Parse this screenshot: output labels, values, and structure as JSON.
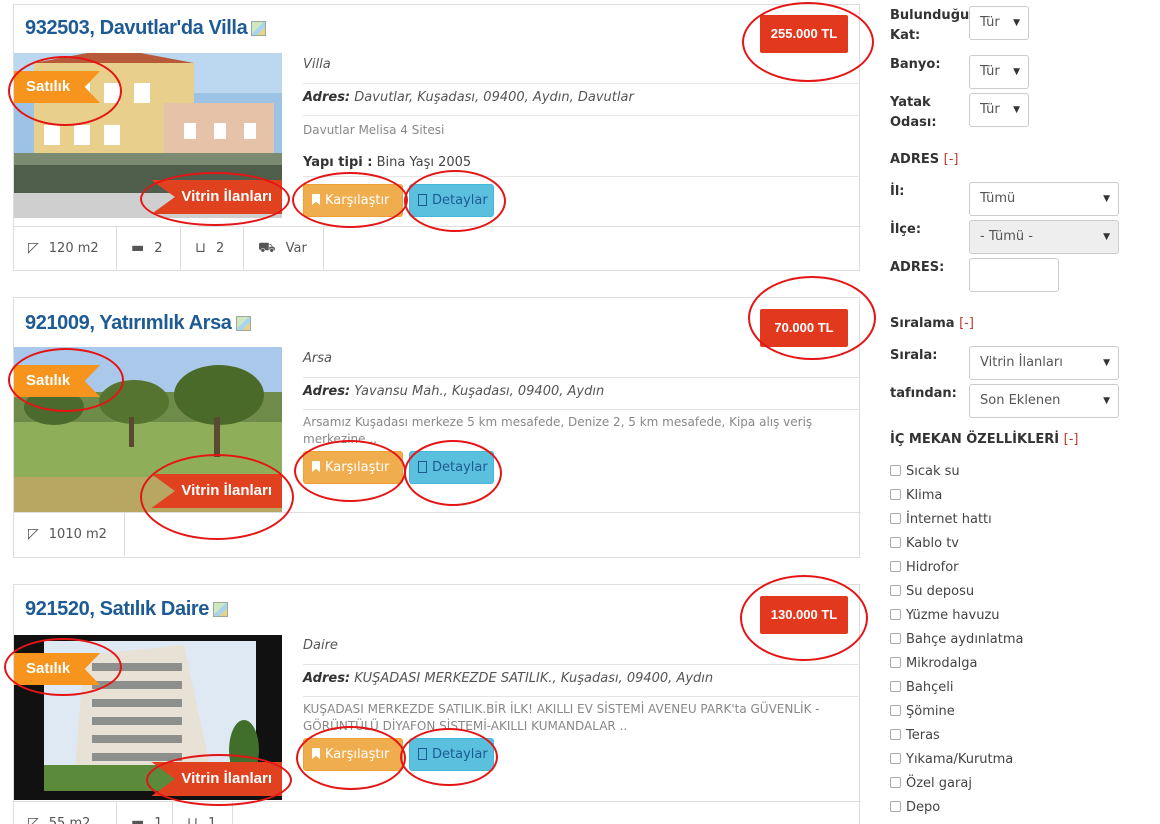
{
  "listings": [
    {
      "title": "932503, Davutlar'da Villa",
      "price": "255.000 TL",
      "tag_sale": "Satılık",
      "tag_showcase": "Vitrin İlanları",
      "type": "Villa",
      "address_label": "Adres:",
      "address": "Davutlar, Kuşadası, 09400, Aydın, Davutlar",
      "description": "Davutlar Melisa 4 Sitesi",
      "yapi_label": "Yapı tipi :",
      "yapi_value": "Bina Yaşı 2005",
      "compare_label": "Karşılaştır",
      "detail_label": "Detaylar",
      "features": [
        {
          "icon": "area-icon",
          "value": "120 m2"
        },
        {
          "icon": "bed-icon",
          "value": "2"
        },
        {
          "icon": "bath-icon",
          "value": "2"
        },
        {
          "icon": "car-icon",
          "value": "Var"
        }
      ]
    },
    {
      "title": "921009, Yatırımlık Arsa",
      "price": "70.000 TL",
      "tag_sale": "Satılık",
      "tag_showcase": "Vitrin İlanları",
      "type": "Arsa",
      "address_label": "Adres:",
      "address": "Yavansu Mah., Kuşadası, 09400, Aydın",
      "description": "Arsamız Kuşadası merkeze 5 km mesafede, Denize 2, 5 km mesafede, Kipa alış veriş merkezine ..",
      "compare_label": "Karşılaştır",
      "detail_label": "Detaylar",
      "features": [
        {
          "icon": "area-icon",
          "value": "1010 m2"
        }
      ]
    },
    {
      "title": "921520, Satılık Daire",
      "price": "130.000 TL",
      "tag_sale": "Satılık",
      "tag_showcase": "Vitrin İlanları",
      "type": "Daire",
      "address_label": "Adres:",
      "address": "KUŞADASI MERKEZDE SATILIK., Kuşadası, 09400, Aydın",
      "description": "KUŞADASI MERKEZDE SATILIK.BİR İLK! AKILLI EV SİSTEMİ AVENEU PARK'ta GÜVENLİK - GÖRÜNTÜLÜ DİYAFON SİSTEMİ-AKILLI KUMANDALAR ..",
      "compare_label": "Karşılaştır",
      "detail_label": "Detaylar",
      "features": [
        {
          "icon": "area-icon",
          "value": "55 m2"
        },
        {
          "icon": "bed-icon",
          "value": "1"
        },
        {
          "icon": "bath-icon",
          "value": "1"
        }
      ]
    }
  ],
  "sidebar": {
    "floor_label": "Bulunduğu Kat:",
    "floor_value": "Tür",
    "bath_label": "Banyo:",
    "bath_value": "Tür",
    "bedroom_label": "Yatak Odası:",
    "bedroom_value": "Tür",
    "address_head": "ADRES",
    "collapse_toggle": "[-]",
    "city_label": "İl:",
    "city_value": "Tümü",
    "district_label": "İlçe:",
    "district_value": "- Tümü -",
    "address_label": "ADRES:",
    "sort_head": "Sıralama",
    "sort_label": "Sırala:",
    "sort_value": "Vitrin İlanları",
    "by_label": "tafından:",
    "by_value": "Son Eklenen",
    "interior_head": "İÇ MEKAN ÖZELLİKLERİ",
    "interior_items": [
      "Sıcak su",
      "Klima",
      "İnternet hattı",
      "Kablo tv",
      "Hidrofor",
      "Su deposu",
      "Yüzme havuzu",
      "Bahçe aydınlatma",
      "Mikrodalga",
      "Bahçeli",
      "Şömine",
      "Teras",
      "Yıkama/Kurutma",
      "Özel garaj",
      "Depo"
    ]
  },
  "colors": {
    "title": "#1e5a94",
    "price": "#e2391e",
    "tag_sale": "#f7941d",
    "tag_showcase": "#e0421f",
    "compare_button": "#f0ad4e",
    "detail_button": "#5bc0de",
    "annotation": "#e51515"
  }
}
